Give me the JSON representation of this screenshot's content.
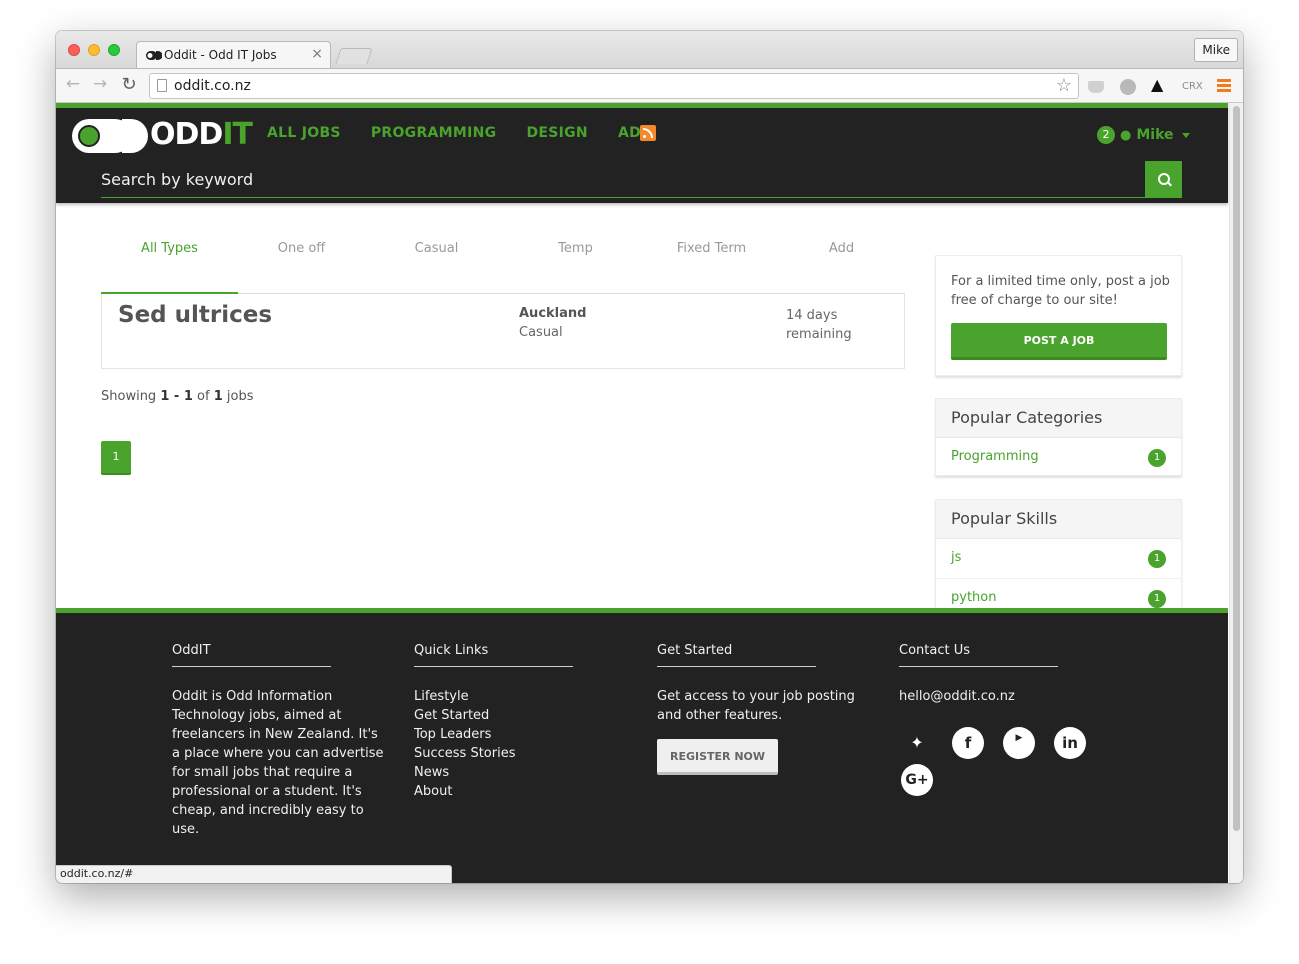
{
  "browser": {
    "tab_title": "Oddit - Odd IT Jobs",
    "tab_close": "×",
    "profile": "Mike",
    "url": "oddit.co.nz",
    "star_icon": "bookmark-star-icon",
    "extension_crx": "CRX",
    "status_url": "oddit.co.nz/#"
  },
  "header": {
    "logo_white": "ODD",
    "logo_green": "IT",
    "nav": [
      "ALL JOBS",
      "PROGRAMMING",
      "DESIGN",
      "ADD"
    ],
    "user_badge": "2",
    "user_name": "Mike",
    "search_placeholder": "Search by keyword"
  },
  "type_tabs": [
    "All Types",
    "One off",
    "Casual",
    "Temp",
    "Fixed Term",
    "Add"
  ],
  "active_tab": "All Types",
  "jobs": [
    {
      "title": "Sed ultrices",
      "location": "Auckland",
      "type": "Casual",
      "remaining": "14 days remaining"
    }
  ],
  "results": {
    "prefix": "Showing",
    "range": "1 - 1",
    "of": "of",
    "total": "1",
    "suffix": "jobs"
  },
  "pagination": {
    "current": "1"
  },
  "sidebar": {
    "promo_text": "For a limited time only, post a job free of charge to our site!",
    "post_button": "POST A JOB",
    "categories_title": "Popular Categories",
    "categories": [
      {
        "label": "Programming",
        "count": "1"
      }
    ],
    "skills_title": "Popular Skills",
    "skills": [
      {
        "label": "js",
        "count": "1"
      },
      {
        "label": "python",
        "count": "1"
      }
    ]
  },
  "footer": {
    "col1_title": "OddIT",
    "col1_text": "Oddit is Odd Information Technology jobs, aimed at freelancers in New Zealand. It's a place where you can advertise for small jobs that require a professional or a student. It's cheap, and incredibly easy to use.",
    "col2_title": "Quick Links",
    "links": [
      "Lifestyle",
      "Get Started",
      "Top Leaders",
      "Success Stories",
      "News",
      "About"
    ],
    "col3_title": "Get Started",
    "col3_text": "Get access to your job posting and other features.",
    "register_button": "REGISTER NOW",
    "col4_title": "Contact Us",
    "email": "hello@oddit.co.nz",
    "social_icons": [
      "twitter-icon",
      "facebook-icon",
      "youtube-icon",
      "linkedin-icon",
      "google-plus-icon"
    ]
  },
  "colors": {
    "brand_green": "#4aa32c",
    "dark": "#222222"
  }
}
